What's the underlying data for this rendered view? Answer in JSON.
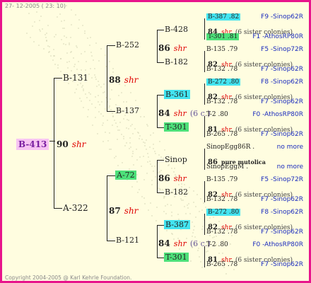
{
  "header": "27- 12-2005 ( 23: 10)",
  "footer": "Copyright 2004-2005 @ Karl Kehrle Foundation.",
  "colors": {
    "frame": "#e8148c",
    "background": "#fffde0",
    "shr": "#e00000",
    "queen": "#1a2bbd",
    "pink": "#f7c4f2",
    "cyan": "#43e4f0",
    "green": "#4de07a"
  },
  "root": {
    "label": "B-413",
    "year": "90",
    "shr": "shr"
  },
  "gen1": [
    {
      "label": "B-131",
      "year": "88",
      "shr": "shr"
    },
    {
      "label": "A-322",
      "year": "87",
      "shr": "shr"
    }
  ],
  "gen2": [
    {
      "label": "B-252",
      "year": "86",
      "shr": "shr"
    },
    {
      "label": "B-137",
      "year": "84",
      "shr": "shr",
      "note": "(6 c.)"
    },
    {
      "label": "A-72",
      "year": "86",
      "shr": "shr"
    },
    {
      "label": "B-121",
      "year": "84",
      "shr": "shr",
      "note": "(6 c.)"
    }
  ],
  "gen3": [
    "B-428",
    "B-182",
    "B-361",
    "T-301",
    "Sinop",
    "B-182",
    "B-387",
    "T-301"
  ],
  "gen4": [
    {
      "top": "B-387 .82",
      "mid": "84",
      "shr": "shr",
      "col": "(6 sister colonies)",
      "bot": "T-301 .81",
      "q1": "F9 -Sinop62R",
      "q2": "F1 -AthosRP80R"
    },
    {
      "top": "B-135 .79",
      "mid": "82",
      "shr": "shr",
      "col": "(6 sister colonies)",
      "bot": "B-132 .78",
      "q1": "F5 -Sinop72R",
      "q2": "F7 -Sinop62R"
    },
    {
      "top": "B-272 .80",
      "mid": "82",
      "shr": "shr",
      "col": "(6 sister colonies)",
      "bot": "B-132 .78",
      "q1": "F8 -Sinop62R",
      "q2": "F7 -Sinop62R"
    },
    {
      "top": "T-2 .80",
      "mid": "81",
      "shr": "shr",
      "col": "(6 sister colonies)",
      "bot": "B-265 .78",
      "q1": "F0 -AthosRP80R",
      "q2": "F7 -Sinop62R"
    },
    {
      "top": "SinopEgg86R .",
      "mid": "86",
      "col": "pure mutolica",
      "bot": "SinopEggM .",
      "q1": "no more",
      "q2": "no more"
    },
    {
      "top": "B-135 .79",
      "mid": "82",
      "shr": "shr",
      "col": "(6 sister colonies)",
      "bot": "B-132 .78",
      "q1": "F5 -Sinop72R",
      "q2": "F7 -Sinop62R"
    },
    {
      "top": "B-272 .80",
      "mid": "82",
      "shr": "shr",
      "col": "(6 sister colonies)",
      "bot": "B-132 .78",
      "q1": "F8 -Sinop62R",
      "q2": "F7 -Sinop62R"
    },
    {
      "top": "T-2 .80",
      "mid": "81",
      "shr": "shr",
      "col": "(6 sister colonies)",
      "bot": "B-265 .78",
      "q1": "F0 -AthosRP80R",
      "q2": "F7 -Sinop62R"
    }
  ]
}
